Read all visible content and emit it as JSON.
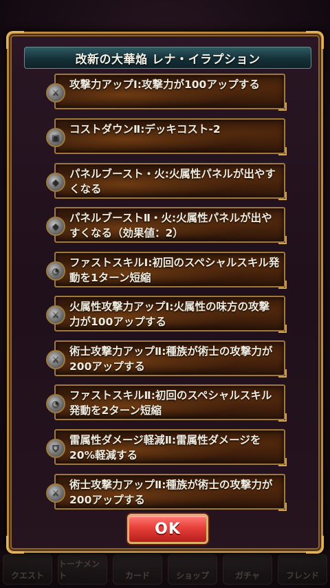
{
  "dialog": {
    "title": "改新の大華焔 レナ・イラプション",
    "ok_label": "OK"
  },
  "skills": [
    {
      "text": "攻撃力アップⅠ:攻撃力が100アップする",
      "icon": "sword-icon"
    },
    {
      "text": "コストダウンⅡ:デッキコスト-2",
      "icon": "card-icon"
    },
    {
      "text": "パネルブースト・火:火属性パネルが出やすくなる",
      "icon": "panel-icon"
    },
    {
      "text": "パネルブーストⅡ・火:火属性パネルが出やすくなる（効果値：2）",
      "icon": "panel-icon"
    },
    {
      "text": "ファストスキルⅠ:初回のスペシャルスキル発動を1ターン短縮",
      "icon": "clock-icon"
    },
    {
      "text": "火属性攻撃力アップⅠ:火属性の味方の攻撃力が100アップする",
      "icon": "sword-icon"
    },
    {
      "text": "術士攻撃力アップⅡ:種族が術士の攻撃力が200アップする",
      "icon": "sword-icon"
    },
    {
      "text": "ファストスキルⅡ:初回のスペシャルスキル発動を2ターン短縮",
      "icon": "clock-icon"
    },
    {
      "text": "雷属性ダメージ軽減Ⅱ:雷属性ダメージを20%軽減する",
      "icon": "shield-icon"
    },
    {
      "text": "術士攻撃力アップⅡ:種族が術士の攻撃力が200アップする",
      "icon": "sword-icon"
    }
  ],
  "bottom_nav": [
    "クエスト",
    "トーナメント",
    "カード",
    "ショップ",
    "ガチャ",
    "フレンド"
  ]
}
